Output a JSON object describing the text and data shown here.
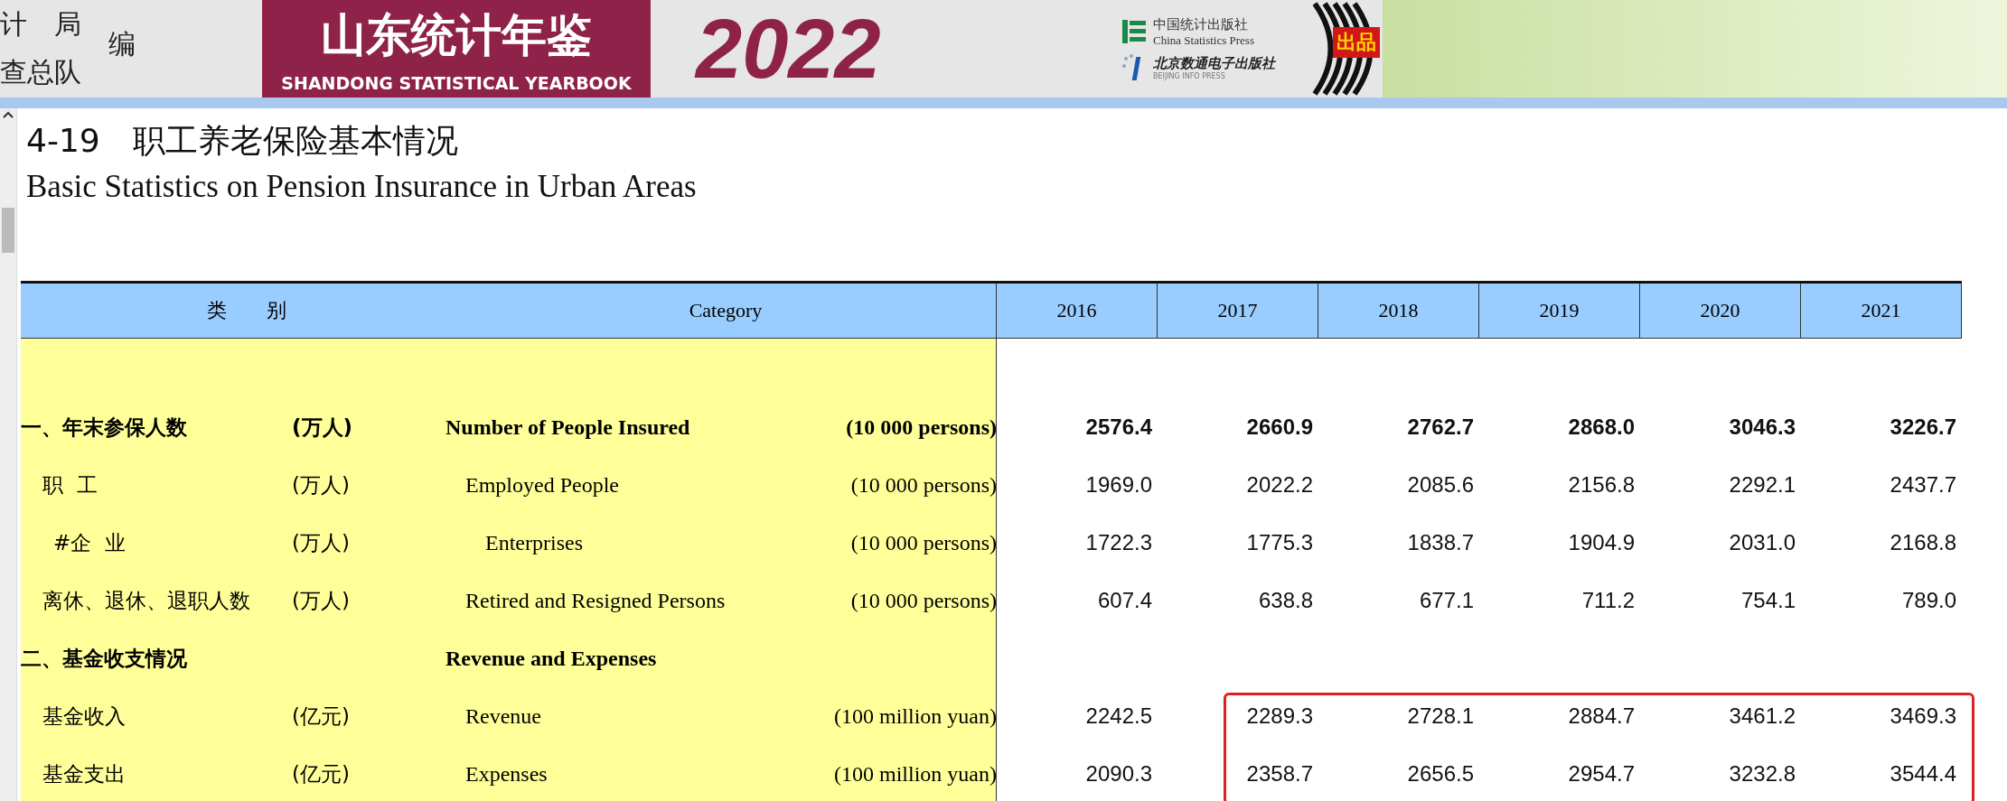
{
  "header": {
    "publisher_lines": [
      "计　局",
      "查总队"
    ],
    "editor_mark": "编",
    "logo_title": "山东统计年鉴",
    "logo_subtitle": "SHANDONG STATISTICAL YEARBOOK",
    "year": "2022",
    "press_1_cn": "中国统计出版社",
    "press_1_en": "China Statistics Press",
    "press_2_cn": "北京数通电子出版社",
    "press_2_en": "BEIJING INFO PRESS",
    "badge": "出品"
  },
  "table_title": "4-19　职工养老保险基本情况",
  "table_subtitle": "Basic Statistics on Pension Insurance in Urban Areas",
  "table": {
    "columns": [
      "类　　别",
      "Category",
      "2016",
      "2017",
      "2018",
      "2019",
      "2020",
      "2021"
    ],
    "rows": [
      {
        "kind": "section",
        "name_cn": "一、年末参保人数",
        "unit_cn": "(万人)",
        "name_en": "Number of People Insured",
        "unit_en": "(10 000 persons)",
        "values": [
          "2576.4",
          "2660.9",
          "2762.7",
          "2868.0",
          "3046.3",
          "3226.7"
        ],
        "children": [
          {
            "kind": "item",
            "name_cn": "职  工",
            "unit_cn": "(万人)",
            "name_en": "Employed People",
            "unit_en": "(10 000 persons)",
            "values": [
              "1969.0",
              "2022.2",
              "2085.6",
              "2156.8",
              "2292.1",
              "2437.7"
            ],
            "children": [
              {
                "kind": "item",
                "name_cn": "#企  业",
                "unit_cn": "(万人)",
                "name_en": "Enterprises",
                "unit_en": "(10 000 persons)",
                "values": [
                  "1722.3",
                  "1775.3",
                  "1838.7",
                  "1904.9",
                  "2031.0",
                  "2168.8"
                ]
              }
            ]
          },
          {
            "kind": "item",
            "name_cn": "离休、退休、退职人数",
            "unit_cn": "(万人)",
            "name_en": "Retired and Resigned Persons",
            "unit_en": "(10 000 persons)",
            "values": [
              "607.4",
              "638.8",
              "677.1",
              "711.2",
              "754.1",
              "789.0"
            ]
          }
        ]
      },
      {
        "kind": "section",
        "name_cn": "二、基金收支情况",
        "name_en": "Revenue and Expenses",
        "children": [
          {
            "kind": "item",
            "name_cn": "基金收入",
            "unit_cn": "(亿元)",
            "name_en": "Revenue",
            "unit_en": "(100 million yuan)",
            "values": [
              "2242.5",
              "2289.3",
              "2728.1",
              "2884.7",
              "3461.2",
              "3469.3"
            ]
          },
          {
            "kind": "item",
            "name_cn": "基金支出",
            "unit_cn": "(亿元)",
            "name_en": "Expenses",
            "unit_en": "(100 million yuan)",
            "values": [
              "2090.3",
              "2358.7",
              "2656.5",
              "2954.7",
              "3232.8",
              "3544.4"
            ]
          }
        ]
      }
    ]
  },
  "annotation": {
    "kind": "frame"
  }
}
